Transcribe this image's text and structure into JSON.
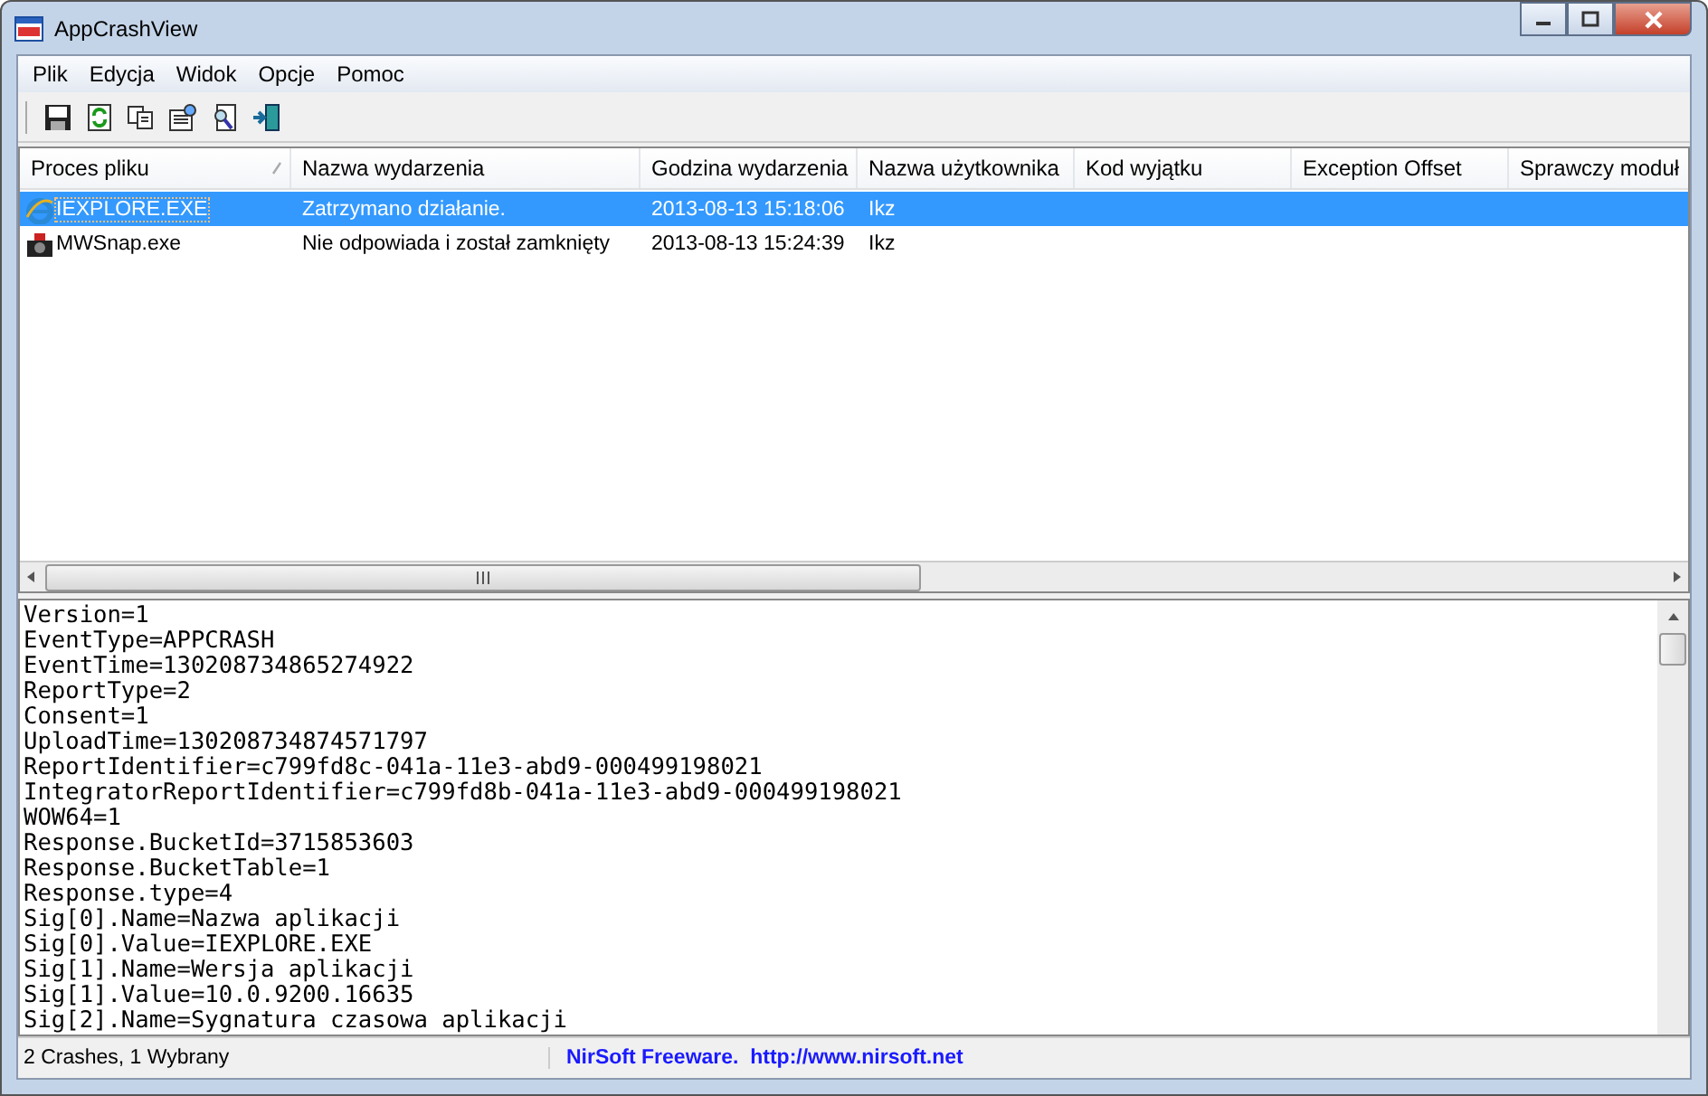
{
  "window": {
    "title": "AppCrashView"
  },
  "menu": [
    "Plik",
    "Edycja",
    "Widok",
    "Opcje",
    "Pomoc"
  ],
  "table": {
    "columns": [
      {
        "label": "Proces pliku",
        "sorted": true
      },
      {
        "label": "Nazwa wydarzenia",
        "sorted": false
      },
      {
        "label": "Godzina wydarzenia",
        "sorted": false
      },
      {
        "label": "Nazwa użytkownika",
        "sorted": false
      },
      {
        "label": "Kod wyjątku",
        "sorted": false
      },
      {
        "label": "Exception Offset",
        "sorted": false
      },
      {
        "label": "Sprawczy moduł",
        "sorted": false
      }
    ],
    "rows": [
      {
        "selected": true,
        "cells": [
          "IEXPLORE.EXE",
          "Zatrzymano działanie.",
          "2013-08-13 15:18:06",
          "Ikz"
        ]
      },
      {
        "selected": false,
        "cells": [
          "MWSnap.exe",
          "Nie odpowiada i został zamknięty",
          "2013-08-13 15:24:39",
          "Ikz"
        ]
      }
    ]
  },
  "report_lines": [
    "Version=1",
    "EventType=APPCRASH",
    "EventTime=130208734865274922",
    "ReportType=2",
    "Consent=1",
    "UploadTime=130208734874571797",
    "ReportIdentifier=c799fd8c-041a-11e3-abd9-000499198021",
    "IntegratorReportIdentifier=c799fd8b-041a-11e3-abd9-000499198021",
    "WOW64=1",
    "Response.BucketId=3715853603",
    "Response.BucketTable=1",
    "Response.type=4",
    "Sig[0].Name=Nazwa aplikacji",
    "Sig[0].Value=IEXPLORE.EXE",
    "Sig[1].Name=Wersja aplikacji",
    "Sig[1].Value=10.0.9200.16635",
    "Sig[2].Name=Sygnatura czasowa aplikacji"
  ],
  "status_bar": {
    "count": "2 Crashes, 1 Wybrany",
    "credit": "NirSoft Freeware.  http://www.nirsoft.net"
  }
}
